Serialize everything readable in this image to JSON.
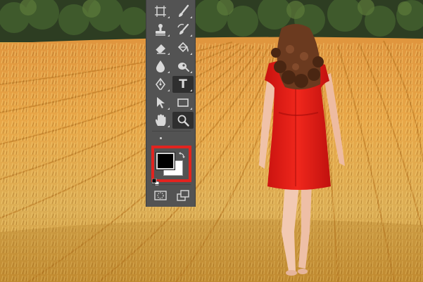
{
  "toolbar": {
    "tools": [
      {
        "name": "artboard-tool",
        "icon": "artboard-icon",
        "row": 0,
        "col": 0,
        "active": false,
        "flyout": true
      },
      {
        "name": "brush-tool",
        "icon": "brush-icon",
        "row": 0,
        "col": 1,
        "active": false,
        "flyout": true
      },
      {
        "name": "clone-stamp-tool",
        "icon": "stamp-icon",
        "row": 1,
        "col": 0,
        "active": false,
        "flyout": true
      },
      {
        "name": "history-brush-tool",
        "icon": "history-brush-icon",
        "row": 1,
        "col": 1,
        "active": false,
        "flyout": true
      },
      {
        "name": "eraser-tool",
        "icon": "eraser-icon",
        "row": 2,
        "col": 0,
        "active": false,
        "flyout": true
      },
      {
        "name": "paint-bucket-tool",
        "icon": "paint-bucket-icon",
        "row": 2,
        "col": 1,
        "active": false,
        "flyout": true
      },
      {
        "name": "blur-tool",
        "icon": "drop-icon",
        "row": 3,
        "col": 0,
        "active": false,
        "flyout": true
      },
      {
        "name": "dodge-tool",
        "icon": "dodge-icon",
        "row": 3,
        "col": 1,
        "active": false,
        "flyout": true
      },
      {
        "name": "pen-tool",
        "icon": "pen-icon",
        "row": 4,
        "col": 0,
        "active": false,
        "flyout": true
      },
      {
        "name": "type-tool",
        "icon": "type-icon",
        "row": 4,
        "col": 1,
        "active": true,
        "flyout": true
      },
      {
        "name": "path-selection-tool",
        "icon": "arrow-cursor-icon",
        "row": 5,
        "col": 0,
        "active": false,
        "flyout": true
      },
      {
        "name": "rectangle-tool",
        "icon": "rectangle-icon",
        "row": 5,
        "col": 1,
        "active": false,
        "flyout": true
      },
      {
        "name": "hand-tool",
        "icon": "hand-icon",
        "row": 6,
        "col": 0,
        "active": false,
        "flyout": true
      },
      {
        "name": "zoom-tool",
        "icon": "zoom-icon",
        "row": 6,
        "col": 1,
        "active": true,
        "flyout": false
      }
    ],
    "type_glyph": "T",
    "more_tools_icon": "ellipsis-icon",
    "bottom": [
      {
        "name": "quick-mask-button",
        "icon": "quick-mask-icon"
      },
      {
        "name": "screen-mode-button",
        "icon": "screen-mode-icon"
      }
    ]
  },
  "colors": {
    "toolbar_bg": "#535353",
    "foreground": "#000000",
    "background": "#ffffff",
    "highlight": "#e2231f",
    "icon": "#d9d9d9"
  }
}
